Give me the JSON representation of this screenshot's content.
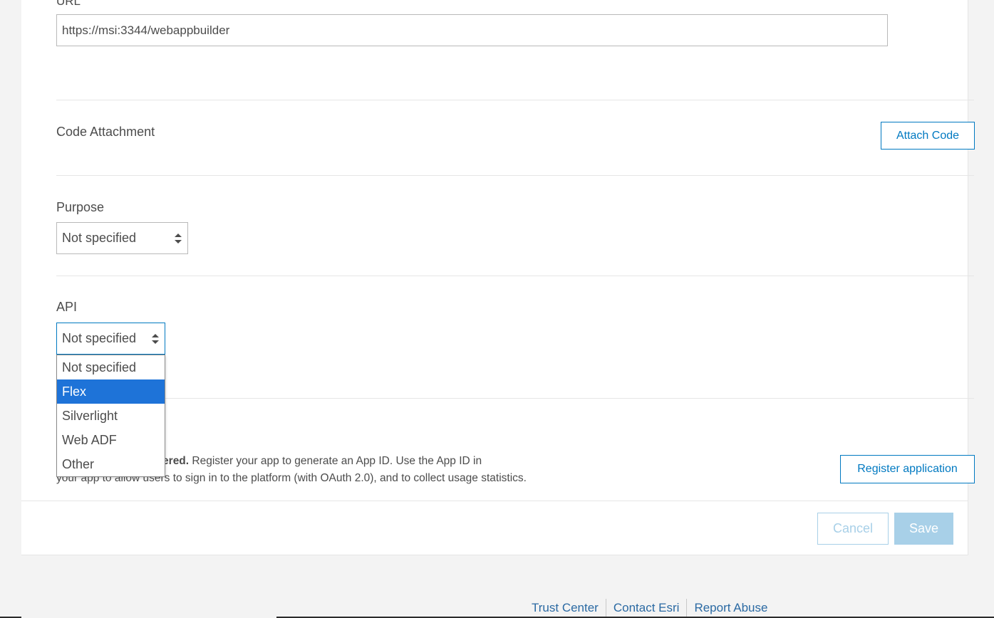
{
  "form": {
    "url_label": "URL",
    "url_value": "https://msi:3344/webappbuilder",
    "code_attachment_label": "Code Attachment",
    "attach_code_label": "Attach Code",
    "purpose_label": "Purpose",
    "purpose_value": "Not specified",
    "api_label": "API",
    "api_value": "Not specified",
    "api_options": [
      "Not specified",
      "Flex",
      "Silverlight",
      "Web ADF",
      "Other"
    ],
    "api_highlighted_option": "Flex",
    "registration_bold": "This app is not registered.",
    "registration_bold_visible": "ot registered.",
    "registration_text": "Register your app to generate an App ID. Use the App ID in",
    "registration_text_line2": "your app to allow users to sign in to the platform (with OAuth 2.0), and to collect usage statistics.",
    "register_button_label": "Register application",
    "cancel_label": "Cancel",
    "save_label": "Save"
  },
  "footer": {
    "links": [
      "Trust Center",
      "Contact Esri",
      "Report Abuse"
    ]
  },
  "colors": {
    "accent": "#0079c1",
    "selected_option": "#1e73d8",
    "disabled_button": "#a8d0e8",
    "background": "#f3f3f3"
  }
}
